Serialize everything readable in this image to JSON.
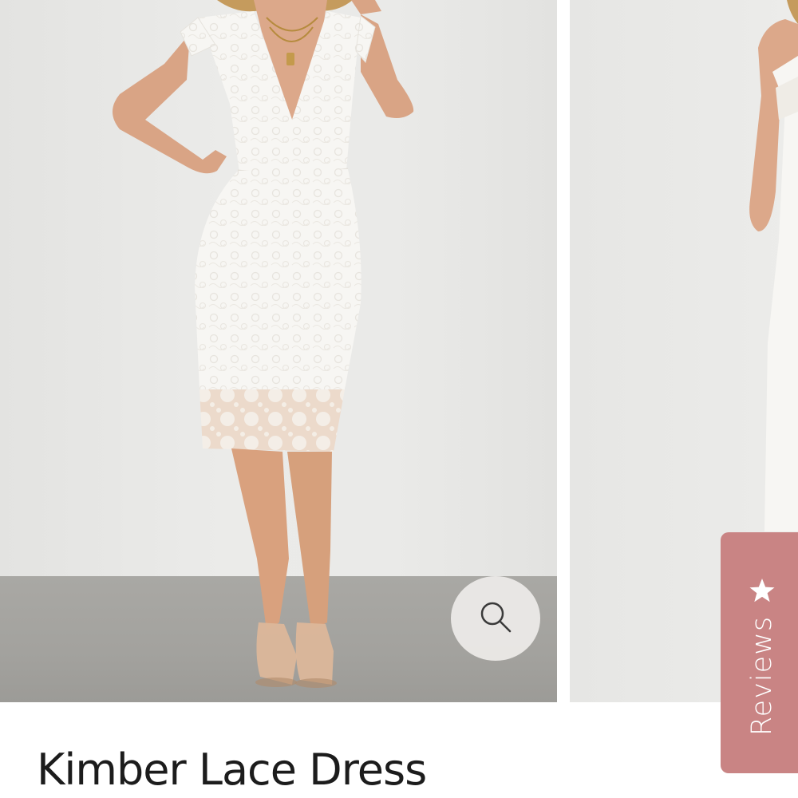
{
  "gallery": {
    "zoom_icon": "magnifier-icon",
    "reviews_icon": "star-icon"
  },
  "reviews_tab": {
    "label": "Reviews",
    "color": "#c98484"
  },
  "product": {
    "title": "Kimber Lace Dress"
  }
}
